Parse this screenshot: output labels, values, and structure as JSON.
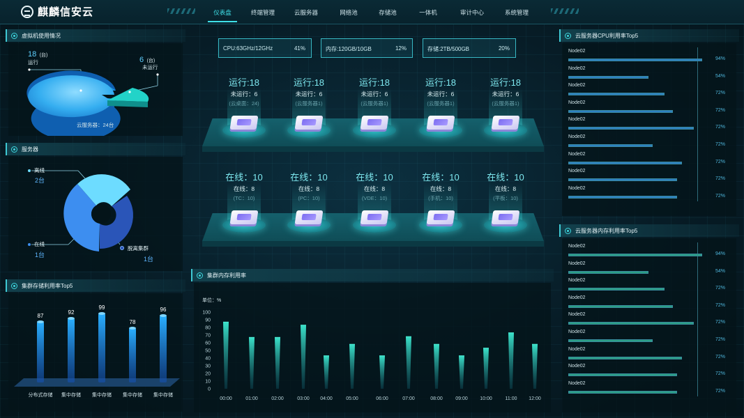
{
  "header": {
    "app_title": "麒麟信安云",
    "nav": [
      "仪表盘",
      "终端管理",
      "云服务器",
      "网络池",
      "存储池",
      "一体机",
      "审计中心",
      "系统管理"
    ],
    "active_nav": 0
  },
  "vm_usage": {
    "title": "虚拟机使用情况",
    "running_count": "18",
    "running_unit": "(台)",
    "running_label": "运行",
    "stopped_count": "6",
    "stopped_unit": "(台)",
    "stopped_label": "未运行",
    "total_label": "云服务器：24台",
    "pie": [
      {
        "label": "运行",
        "value": 18
      },
      {
        "label": "未运行",
        "value": 6
      }
    ]
  },
  "servers": {
    "title": "服务器",
    "offline_label": "离线",
    "offline_value": "2台",
    "online_label": "在线",
    "online_value": "1台",
    "detached_label": "脱离集群",
    "detached_value": "1台"
  },
  "storage_top5": {
    "title": "集群存储利用率Top5",
    "chart_data": {
      "type": "bar",
      "categories": [
        "分布式存储",
        "集中存储",
        "集中存储",
        "集中存储",
        "集中存储"
      ],
      "values": [
        87,
        92,
        99,
        78,
        96
      ],
      "ylim": [
        0,
        100
      ]
    }
  },
  "stats": [
    {
      "label": "CPU:63GHz/12GHz",
      "pct": "41%"
    },
    {
      "label": "内存:120GB/10GB",
      "pct": "12%"
    },
    {
      "label": "存储:2TB/500GB",
      "pct": "20%"
    }
  ],
  "server_nodes": [
    {
      "big": "运行:18",
      "sub": "未运行：6",
      "note": "(云桌面：24)"
    },
    {
      "big": "运行:18",
      "sub": "未运行：6",
      "note": "(云服务器1)"
    },
    {
      "big": "运行:18",
      "sub": "未运行：6",
      "note": "(云服务器1)"
    },
    {
      "big": "运行:18",
      "sub": "未运行：6",
      "note": "(云服务器1)"
    },
    {
      "big": "运行:18",
      "sub": "未运行：6",
      "note": "(云服务器1)"
    }
  ],
  "terminal_nodes": [
    {
      "big": "在线：10",
      "sub": "在线：8",
      "note": "(TC：10)"
    },
    {
      "big": "在线：10",
      "sub": "在线：8",
      "note": "(PC：10)"
    },
    {
      "big": "在线：10",
      "sub": "在线：8",
      "note": "(VDE：10)"
    },
    {
      "big": "在线：10",
      "sub": "在线：8",
      "note": "(手机：10)"
    },
    {
      "big": "在线：10",
      "sub": "在线：8",
      "note": "(平板：10)"
    }
  ],
  "cluster_mem": {
    "title": "集群内存利用率",
    "unit": "单位：%",
    "chart_data": {
      "type": "bar",
      "categories": [
        "00:00",
        "01:00",
        "02:00",
        "03:00",
        "04:00",
        "05:00",
        "06:00",
        "07:00",
        "08:00",
        "09:00",
        "10:00",
        "11:00",
        "12:00"
      ],
      "x_ticks": [
        "00:00",
        "01:00",
        "02:00",
        "03:00",
        "04:00",
        "05:00",
        "06:00",
        "07:00",
        "08:00",
        "09:00",
        "10:00",
        "11:00",
        "12:00"
      ],
      "values": [
        87,
        67,
        67,
        83,
        43,
        58,
        43,
        68,
        58,
        43,
        53,
        73,
        58
      ],
      "y_ticks": [
        "100",
        "90",
        "80",
        "70",
        "60",
        "50",
        "40",
        "30",
        "20",
        "10",
        "0"
      ],
      "ylim": [
        0,
        100
      ]
    }
  },
  "cpu_top5": {
    "title": "云服务器CPU利用率Top5",
    "chart_data": {
      "type": "bar",
      "rows": [
        {
          "name": "Node02",
          "value": 94,
          "label": "94%"
        },
        {
          "name": "Node02",
          "value": 54,
          "label": "54%"
        },
        {
          "name": "Node02",
          "value": 72,
          "label": "72%"
        },
        {
          "name": "Node02",
          "value": 72,
          "label": "72%"
        },
        {
          "name": "Node02",
          "value": 72,
          "label": "72%"
        },
        {
          "name": "Node02",
          "value": 72,
          "label": "72%"
        },
        {
          "name": "Node02",
          "value": 72,
          "label": "72%"
        },
        {
          "name": "Node02",
          "value": 72,
          "label": "72%"
        },
        {
          "name": "Node02",
          "value": 72,
          "label": "72%"
        }
      ],
      "bar_fractions": [
        1.0,
        0.6,
        0.72,
        0.78,
        0.94,
        0.63,
        0.85,
        0.81,
        0.81
      ]
    },
    "color": "#2c7ec0"
  },
  "mem_top5": {
    "title": "云服务器内存利用率Top5",
    "chart_data": {
      "type": "bar",
      "rows": [
        {
          "name": "Node02",
          "value": 94,
          "label": "94%"
        },
        {
          "name": "Node02",
          "value": 54,
          "label": "54%"
        },
        {
          "name": "Node02",
          "value": 72,
          "label": "72%"
        },
        {
          "name": "Node02",
          "value": 72,
          "label": "72%"
        },
        {
          "name": "Node02",
          "value": 72,
          "label": "72%"
        },
        {
          "name": "Node02",
          "value": 72,
          "label": "72%"
        },
        {
          "name": "Node02",
          "value": 72,
          "label": "72%"
        },
        {
          "name": "Node02",
          "value": 72,
          "label": "72%"
        },
        {
          "name": "Node02",
          "value": 72,
          "label": "72%"
        }
      ],
      "bar_fractions": [
        1.0,
        0.6,
        0.72,
        0.78,
        0.94,
        0.63,
        0.85,
        0.81,
        0.81
      ]
    },
    "color": "#2a9e82"
  }
}
